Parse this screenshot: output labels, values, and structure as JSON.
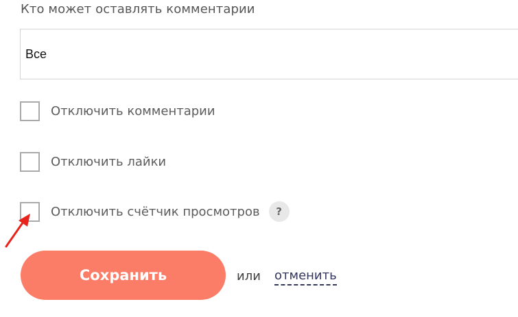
{
  "comments_section": {
    "label": "Кто может оставлять комментарии",
    "select_value": "Все"
  },
  "options": [
    {
      "label": "Отключить комментарии",
      "checked": false
    },
    {
      "label": "Отключить лайки",
      "checked": false
    },
    {
      "label": "Отключить счётчик просмотров",
      "checked": false,
      "help_icon": "?"
    }
  ],
  "actions": {
    "save_label": "Сохранить",
    "or_text": "или",
    "cancel_label": "отменить"
  },
  "colors": {
    "save_button": "#fb7d67",
    "link": "#33365c",
    "annotation_arrow": "#e8231c"
  },
  "icons": {
    "help": "question-mark-icon",
    "annotation": "red-arrow-icon"
  }
}
